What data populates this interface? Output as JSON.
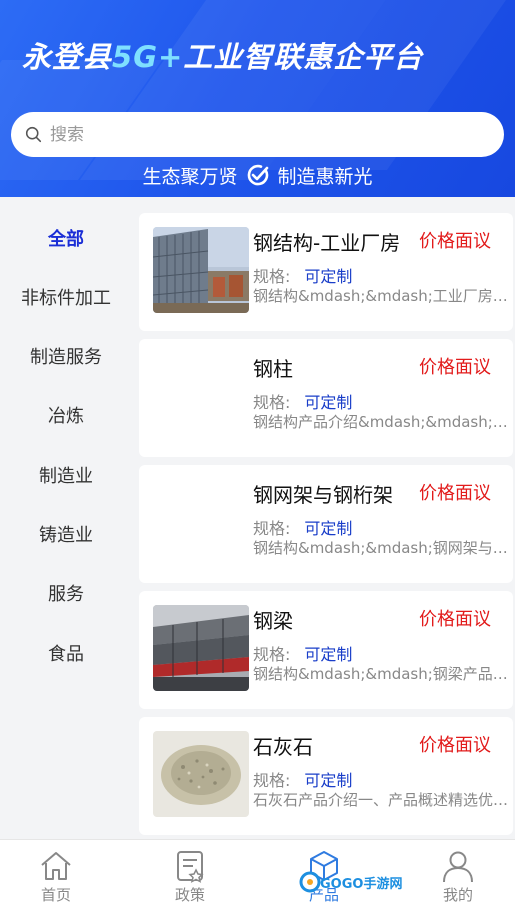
{
  "header": {
    "title_prefix": "永登县",
    "title_highlight": "5G+",
    "title_suffix": "工业智联惠企平台",
    "slogan_left": "生态聚万贤",
    "slogan_right": "制造惠新光"
  },
  "search": {
    "placeholder": "搜索",
    "value": ""
  },
  "sidebar": {
    "items": [
      {
        "label": "全部",
        "active": true
      },
      {
        "label": "非标件加工"
      },
      {
        "label": "制造服务"
      },
      {
        "label": "冶炼"
      },
      {
        "label": "制造业"
      },
      {
        "label": "铸造业"
      },
      {
        "label": "服务"
      },
      {
        "label": "食品"
      }
    ]
  },
  "products": [
    {
      "name": "钢结构-工业厂房",
      "price": "价格面议",
      "spec_label": "规格:",
      "spec_value": "可定制",
      "desc": "钢结构&mdash;&mdash;工业厂房产品介绍",
      "image": "factory-building-photo"
    },
    {
      "name": "钢柱",
      "price": "价格面议",
      "spec_label": "规格:",
      "spec_value": "可定制",
      "desc": "钢结构产品介绍&mdash;&mdash;钢柱产品概述",
      "image": ""
    },
    {
      "name": "钢网架与钢桁架",
      "price": "价格面议",
      "spec_label": "规格:",
      "spec_value": "可定制",
      "desc": "钢结构&mdash;&mdash;钢网架与钢桁架产品",
      "image": ""
    },
    {
      "name": "钢梁",
      "price": "价格面议",
      "spec_label": "规格:",
      "spec_value": "可定制",
      "desc": "钢结构&mdash;&mdash;钢梁产品介绍概述",
      "image": "steel-beam-photo"
    },
    {
      "name": "石灰石",
      "price": "价格面议",
      "spec_label": "规格:",
      "spec_value": "可定制",
      "desc": "石灰石产品介绍一、产品概述精选优质石灰石",
      "image": "limestone-photo"
    }
  ],
  "tabbar": {
    "items": [
      {
        "label": "首页",
        "icon": "home-icon"
      },
      {
        "label": "政策",
        "icon": "policy-icon"
      },
      {
        "label": "产品",
        "icon": "product-cube-icon",
        "active": true
      },
      {
        "label": "我的",
        "icon": "user-icon"
      }
    ]
  },
  "watermark": {
    "text": "GOGO手游网"
  }
}
